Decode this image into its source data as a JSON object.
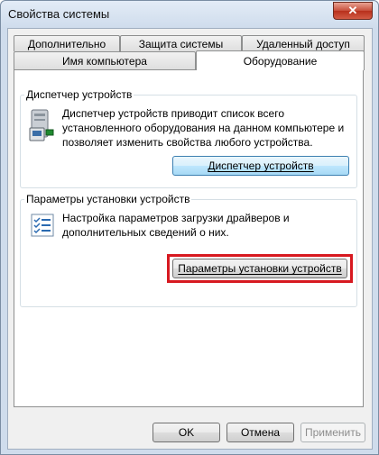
{
  "window": {
    "title": "Свойства системы"
  },
  "tabs": {
    "row1": [
      "Дополнительно",
      "Защита системы",
      "Удаленный доступ"
    ],
    "row2": [
      "Имя компьютера",
      "Оборудование"
    ],
    "active": "Оборудование"
  },
  "device_manager": {
    "group_title": "Диспетчер устройств",
    "description": "Диспетчер устройств приводит список всего установленного оборудования на данном компьютере и позволяет изменить свойства любого устройства.",
    "button": "Диспетчер устройств",
    "icon": "device-manager-icon"
  },
  "device_install": {
    "group_title": "Параметры установки устройств",
    "description": "Настройка параметров загрузки драйверов и дополнительных сведений о них.",
    "button": "Параметры установки устройств",
    "icon": "checklist-icon",
    "highlight_color": "#d71920"
  },
  "footer": {
    "ok": "OK",
    "cancel": "Отмена",
    "apply": "Применить"
  }
}
